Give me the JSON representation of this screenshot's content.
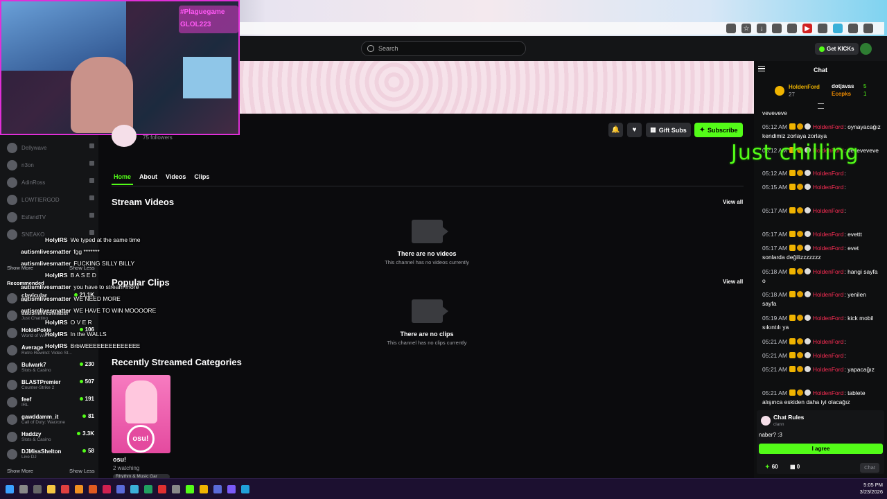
{
  "overlay": {
    "webcam_text": [
      "#Plaguegame",
      "GLOL223"
    ],
    "stream_chat": [
      {
        "user": "HolyIRS",
        "msg": "We typed at the same time"
      },
      {
        "user": "autismlivesmatter",
        "msg": "fgg *******"
      },
      {
        "user": "autismlivesmatter",
        "msg": "FUCKING SILLY BILLY"
      },
      {
        "user": "HolyIRS",
        "msg": "B A S E D"
      },
      {
        "user": "autismlivesmatter",
        "msg": "you have to stream more"
      },
      {
        "user": "autismlivesmatter",
        "msg": "WE NEED MORE"
      },
      {
        "user": "autismlivesmatter",
        "msg": "WE HAVE TO WIN MOOOORE"
      },
      {
        "user": "HolyIRS",
        "msg": "O V E R"
      },
      {
        "user": "HolyIRS",
        "msg": "In the WALLS"
      },
      {
        "user": "HolyIRS",
        "msg": "BrbWEEEEEEEEEEEEEE"
      }
    ],
    "just_chilling": "Just chilling"
  },
  "header": {
    "search_placeholder": "Search",
    "get_kicks": "Get KICKs"
  },
  "sidebar": {
    "offline": [
      "Dellywave",
      "n3on",
      "AdinRoss",
      "LOWTIERGOD",
      "EsfandTV",
      "SNEAKO"
    ],
    "show_more": "Show More",
    "show_less": "Show Less",
    "recommended_label": "Recommended",
    "recommended": [
      {
        "name": "clavicular",
        "cat": "IRL",
        "count": "21.1K"
      },
      {
        "name": "autismlivesmatter",
        "cat": "Just Chatting",
        "count": ""
      },
      {
        "name": "HokiePokie",
        "cat": "World of Warcraft",
        "count": "106"
      },
      {
        "name": "Average",
        "cat": "Retro Rewind: Video St...",
        "count": ""
      },
      {
        "name": "Bulwark7",
        "cat": "Slots & Casino",
        "count": "230"
      },
      {
        "name": "BLASTPremier",
        "cat": "Counter-Strike 2",
        "count": "507"
      },
      {
        "name": "feef",
        "cat": "IRL",
        "count": "191"
      },
      {
        "name": "gawddamm_it",
        "cat": "Call of Duty: Warzone",
        "count": "81"
      },
      {
        "name": "Haddzy",
        "cat": "Slots & Casino",
        "count": "3.3K"
      },
      {
        "name": "DJMissShelton",
        "cat": "Live DJ",
        "count": "58"
      }
    ]
  },
  "channel": {
    "followers": "75 followers",
    "gift_subs": "Gift Subs",
    "subscribe": "Subscribe",
    "tabs": [
      "Home",
      "About",
      "Videos",
      "Clips"
    ],
    "stream_videos_title": "Stream Videos",
    "popular_clips_title": "Popular Clips",
    "view_all": "View all",
    "no_videos_title": "There are no videos",
    "no_videos_sub": "This channel has no videos currently",
    "no_clips_title": "There are no clips",
    "no_clips_sub": "This channel has no clips currently",
    "recent_categories_title": "Recently Streamed Categories",
    "category": {
      "name": "osu!",
      "watching": "2 watching",
      "tag": "Rhythm & Music Gar",
      "logo": "osu!"
    }
  },
  "chat": {
    "title": "Chat",
    "gifters": {
      "top_name": "HoldenFord",
      "top_count": "27",
      "second": "dotjavas",
      "second_count": "5",
      "third": "Ecepks",
      "third_count": "1"
    },
    "messages": [
      {
        "time": "",
        "user": "",
        "text": "veveveve"
      },
      {
        "time": "05:12 AM",
        "user": "HoldenFord",
        "text": ": oynayacağız kendimiz zorlaya zorlaya"
      },
      {
        "time": "05:12 AM",
        "user": "HoldenFord",
        "text": ": veveveveve"
      },
      {
        "time": "05:12 AM",
        "user": "HoldenFord",
        "text": ":"
      },
      {
        "time": "05:15 AM",
        "user": "HoldenFord",
        "text": ":"
      },
      {
        "time": "05:17 AM",
        "user": "HoldenFord",
        "text": ":"
      },
      {
        "time": "05:17 AM",
        "user": "HoldenFord",
        "text": ": evettt"
      },
      {
        "time": "05:17 AM",
        "user": "HoldenFord",
        "text": ": evet sonlarda değilizzzzzzz"
      },
      {
        "time": "05:18 AM",
        "user": "HoldenFord",
        "text": ": hangi sayfa o"
      },
      {
        "time": "05:18 AM",
        "user": "HoldenFord",
        "text": ": yenilen sayfa"
      },
      {
        "time": "05:19 AM",
        "user": "HoldenFord",
        "text": ": kick mobil sıkıntılı ya"
      },
      {
        "time": "05:21 AM",
        "user": "HoldenFord",
        "text": ":"
      },
      {
        "time": "05:21 AM",
        "user": "HoldenFord",
        "text": ":"
      },
      {
        "time": "05:21 AM",
        "user": "HoldenFord",
        "text": ": yapacağız"
      },
      {
        "time": "05:21 AM",
        "user": "HoldenFord",
        "text": ": tablete alışınca eskiden daha iyi olacağız"
      }
    ],
    "rules_title": "Chat Rules",
    "rules_sub": "clann",
    "rules_text": "naber? :3",
    "agree": "I agree",
    "points": "60",
    "gifts": "0",
    "send": "Chat"
  },
  "taskbar": {
    "time": "5:05 PM",
    "date": "3/23/2026"
  }
}
